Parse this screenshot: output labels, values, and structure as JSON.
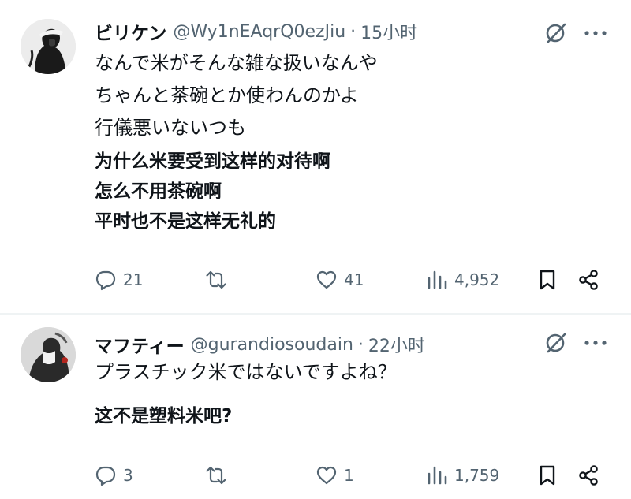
{
  "tweets": [
    {
      "display_name": "ビリケン",
      "handle": "@Wy1nEAqrQ0ezJiu",
      "separator": "·",
      "time": "15小时",
      "original_lines": [
        "なんで米がそんな雑な扱いなんや",
        "ちゃんと茶碗とか使わんのかよ",
        "行儀悪いないつも"
      ],
      "translation_lines": [
        "为什么米要受到这样的对待啊",
        "怎么不用茶碗啊",
        "平时也不是这样无礼的"
      ],
      "actions": {
        "reply_count": "21",
        "repost_count": "",
        "like_count": "41",
        "view_count": "4,952"
      }
    },
    {
      "display_name": "マフティー",
      "handle": "@gurandiosoudain",
      "separator": "·",
      "time": "22小时",
      "original_lines": [
        "プラスチック米ではないですよね？"
      ],
      "translation_lines": [
        "这不是塑料米吧?"
      ],
      "actions": {
        "reply_count": "3",
        "repost_count": "",
        "like_count": "1",
        "view_count": "1,759"
      }
    }
  ],
  "icons": {
    "grok": "grok-icon",
    "more": "more-icon",
    "reply": "reply-icon",
    "repost": "repost-icon",
    "like": "heart-icon",
    "views": "views-icon",
    "bookmark": "bookmark-icon",
    "share": "share-icon"
  },
  "colors": {
    "text_primary": "#0f1419",
    "text_secondary": "#536471",
    "divider": "#eff3f4"
  }
}
